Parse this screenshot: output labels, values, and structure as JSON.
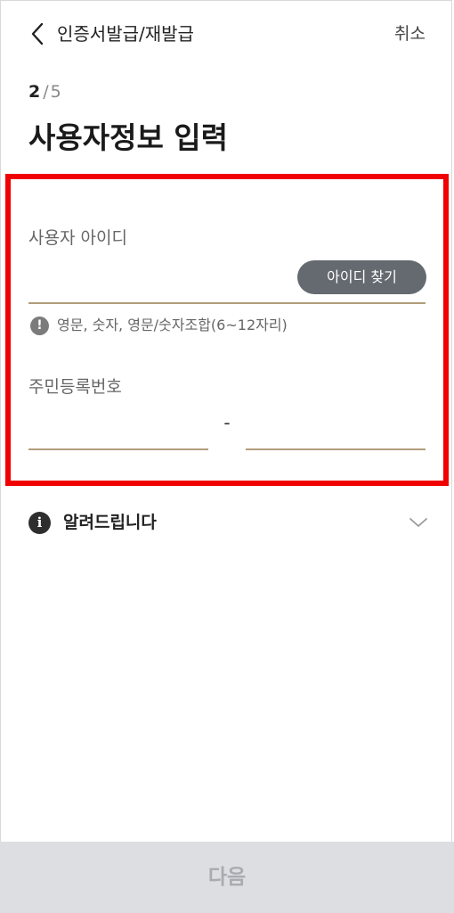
{
  "header": {
    "title": "인증서발급/재발급",
    "cancel_label": "취소",
    "back_icon": "chevron-left-icon"
  },
  "step": {
    "current": "2",
    "separator": "/",
    "total": "5"
  },
  "page_title": "사용자정보 입력",
  "user_id": {
    "label": "사용자 아이디",
    "value": "",
    "placeholder": "",
    "find_button_label": "아이디 찾기",
    "hint_icon": "exclamation-icon",
    "hint_icon_glyph": "!",
    "hint": "영문, 숫자, 영문/숫자조합(6~12자리)"
  },
  "rrn": {
    "label": "주민등록번호",
    "front_value": "",
    "back_value": "",
    "separator": "-"
  },
  "notice": {
    "icon": "info-icon",
    "icon_glyph": "i",
    "label": "알려드립니다",
    "chevron_icon": "chevron-down-icon"
  },
  "footer": {
    "next_label": "다음"
  },
  "colors": {
    "highlight_border": "#f00000",
    "input_underline": "#b29d7c",
    "find_button_bg": "#656a70",
    "next_button_bg": "#dcdee2",
    "next_button_text": "#a8abb0"
  }
}
